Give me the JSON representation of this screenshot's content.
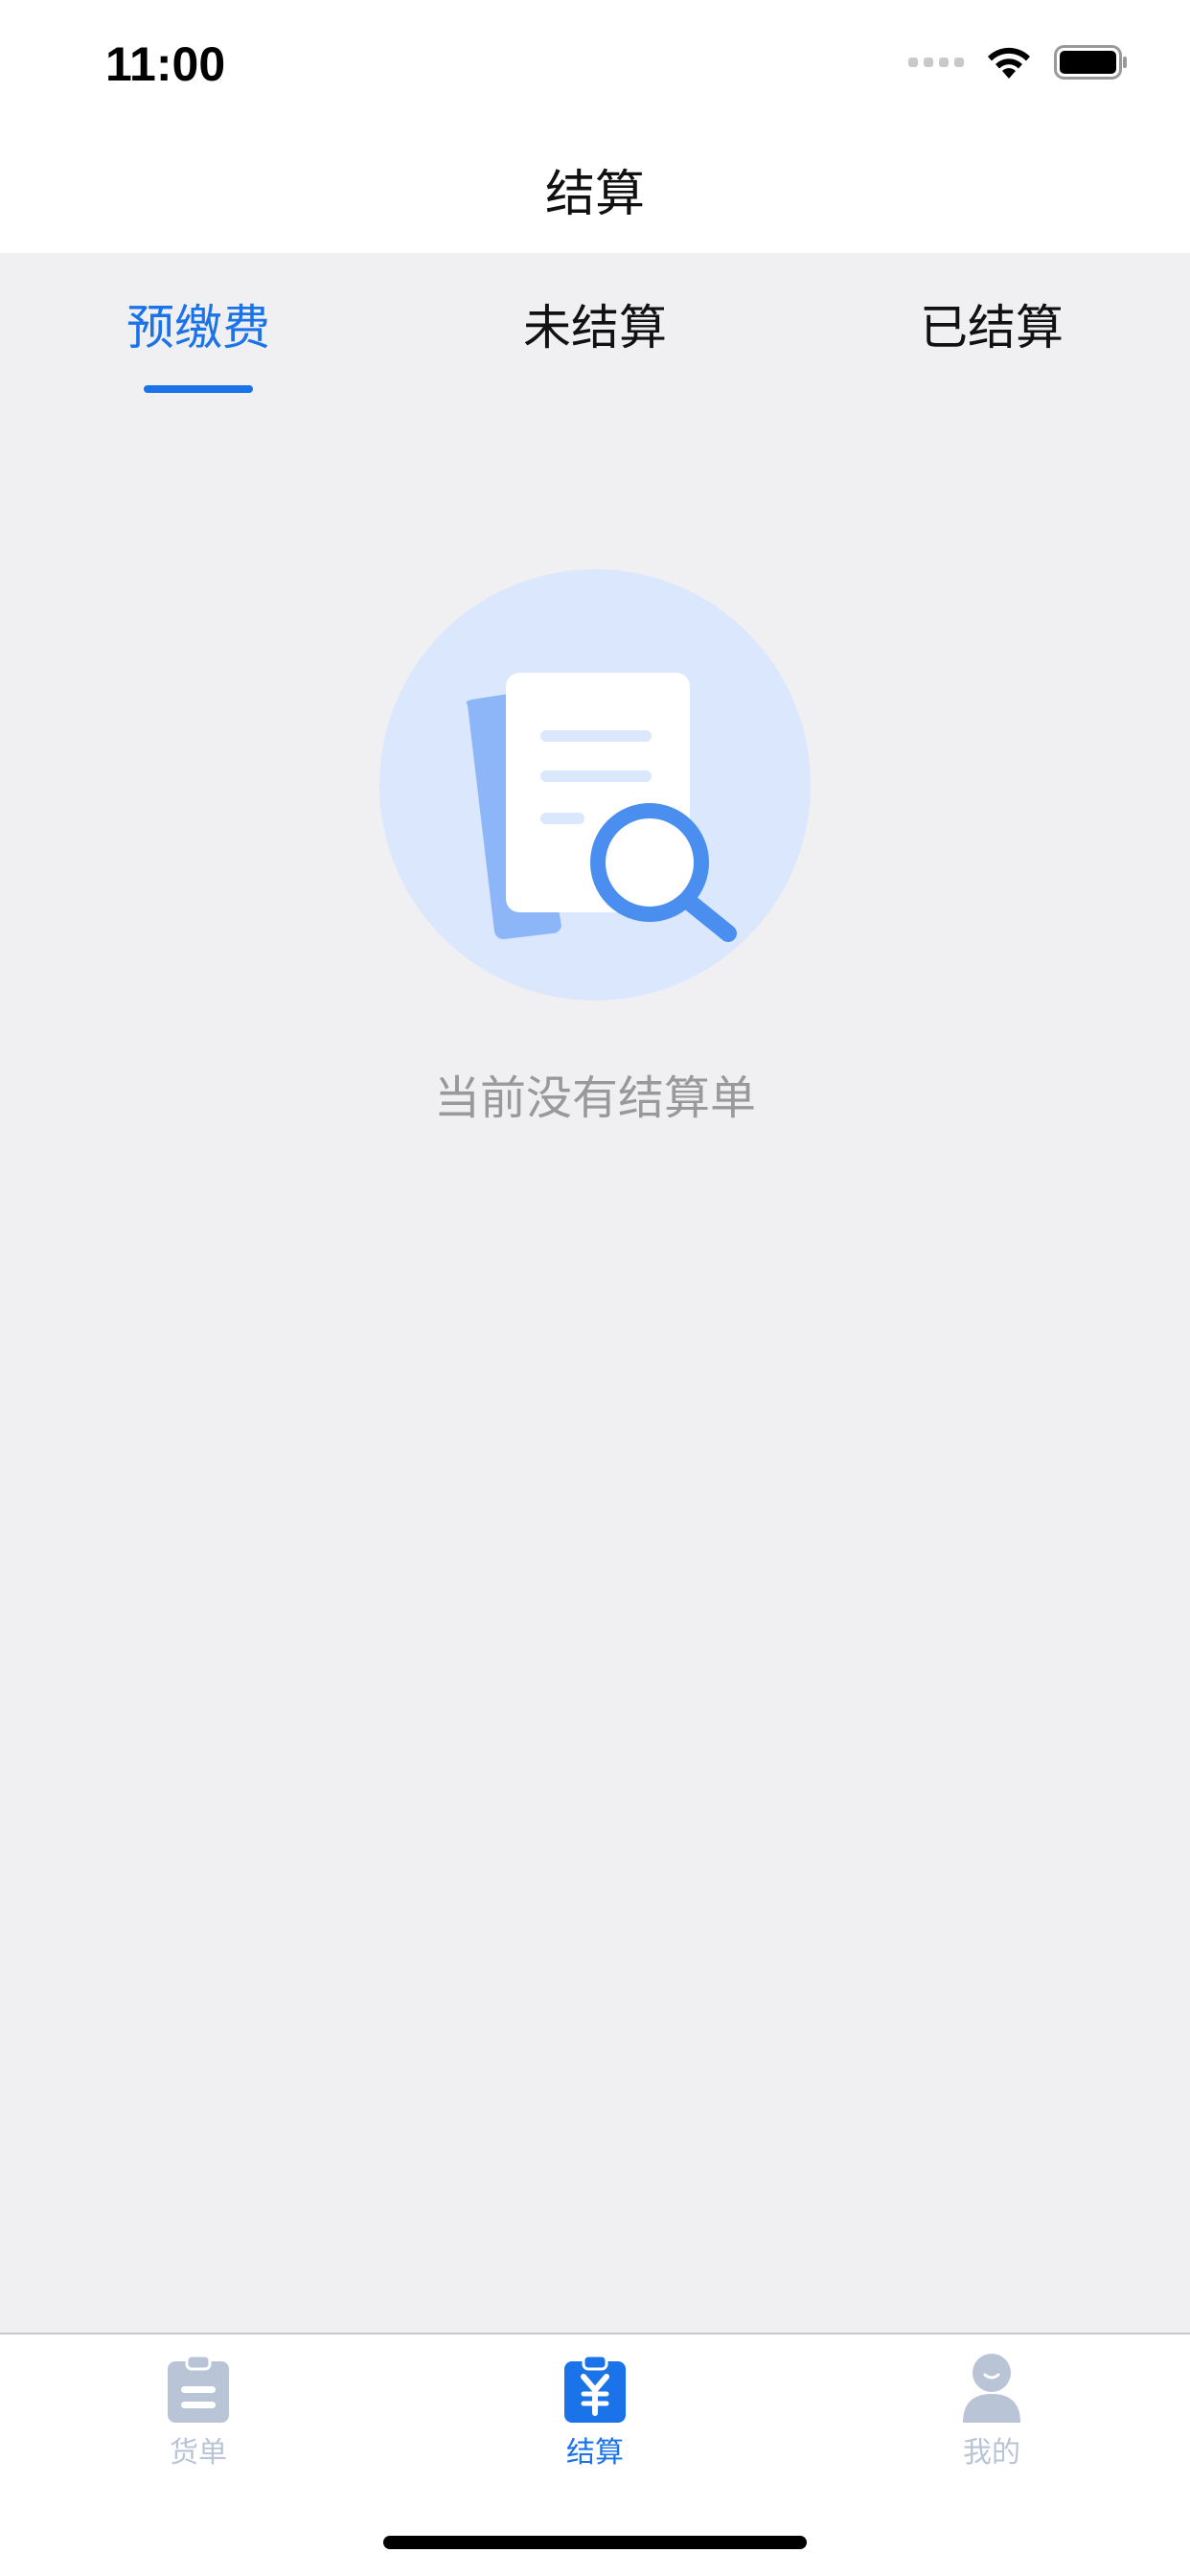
{
  "status_bar": {
    "time": "11:00"
  },
  "nav": {
    "title": "结算"
  },
  "tabs": [
    {
      "label": "预缴费",
      "active": true
    },
    {
      "label": "未结算",
      "active": false
    },
    {
      "label": "已结算",
      "active": false
    }
  ],
  "empty_state": {
    "message": "当前没有结算单",
    "icon": "document-search-icon"
  },
  "bottom_nav": [
    {
      "label": "货单",
      "icon": "clipboard-list-icon",
      "active": false
    },
    {
      "label": "结算",
      "icon": "clipboard-yen-icon",
      "active": true
    },
    {
      "label": "我的",
      "icon": "user-icon",
      "active": false
    }
  ],
  "colors": {
    "accent": "#1a73e8",
    "inactive_icon": "#b9c4d6",
    "background": "#f0f0f3",
    "muted_text": "#999999"
  }
}
